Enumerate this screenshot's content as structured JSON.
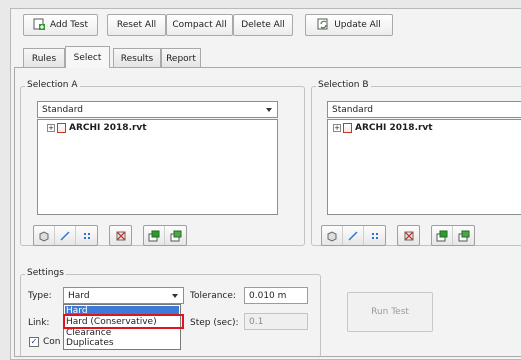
{
  "toolbar": {
    "add_test": "Add Test",
    "reset_all": "Reset All",
    "compact_all": "Compact All",
    "delete_all": "Delete All",
    "update_all": "Update All"
  },
  "tabs": [
    "Rules",
    "Select",
    "Results",
    "Report"
  ],
  "selection_a": {
    "label": "Selection A",
    "dropdown": "Standard",
    "tree_item": "ARCHI 2018.rvt"
  },
  "selection_b": {
    "label": "Selection B",
    "dropdown": "Standard",
    "tree_item": "ARCHI 2018.rvt"
  },
  "settings": {
    "label": "Settings",
    "type_label": "Type:",
    "type_value": "Hard",
    "tolerance_label": "Tolerance:",
    "tolerance_value": "0.010 m",
    "link_label": "Link:",
    "step_label": "Step (sec):",
    "step_value": "0.1",
    "checkbox_label": "Con",
    "run_test": "Run Test",
    "type_options": [
      "Hard",
      "Hard (Conservative)",
      "Clearance",
      "Duplicates"
    ]
  },
  "colors": {
    "highlight": "#3d79d6",
    "annotation_box": "#e0141e"
  }
}
